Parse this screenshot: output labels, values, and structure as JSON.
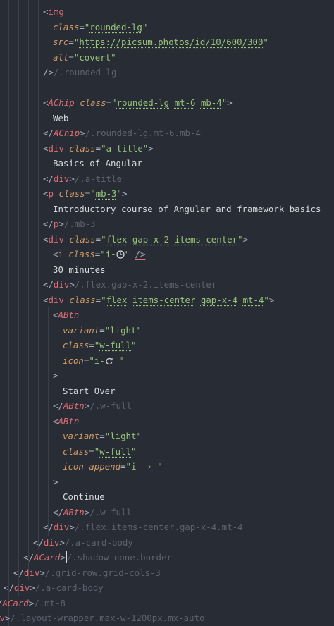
{
  "lines": [
    {
      "t": [
        [
          "p",
          "<"
        ],
        [
          "tag",
          "img"
        ]
      ]
    },
    {
      "t": [
        [
          "attr",
          "class"
        ],
        [
          "p",
          "="
        ],
        [
          "str",
          "\""
        ],
        [
          "str",
          "rounded-lg",
          "u"
        ],
        [
          "str",
          "\""
        ]
      ]
    },
    {
      "t": [
        [
          "attr",
          "src"
        ],
        [
          "p",
          "="
        ],
        [
          "str",
          "\""
        ],
        [
          "str",
          "https://picsum.photos/id/10/600/300",
          "u"
        ],
        [
          "str",
          "\""
        ]
      ]
    },
    {
      "t": [
        [
          "attr",
          "alt"
        ],
        [
          "p",
          "="
        ],
        [
          "str",
          "\"covert\""
        ]
      ]
    },
    {
      "t": [
        [
          "p",
          "/>"
        ],
        [
          "c",
          "/.rounded-lg"
        ]
      ]
    },
    {
      "t": []
    },
    {
      "t": [
        [
          "p",
          "<"
        ],
        [
          "comp",
          "AChip"
        ],
        [
          "p",
          " "
        ],
        [
          "attr",
          "class"
        ],
        [
          "p",
          "="
        ],
        [
          "str",
          "\""
        ],
        [
          "str",
          "rounded-lg",
          "u"
        ],
        [
          "str",
          " "
        ],
        [
          "str",
          "mt-6",
          "u"
        ],
        [
          "str",
          " "
        ],
        [
          "str",
          "mb-4",
          "u"
        ],
        [
          "str",
          "\""
        ],
        [
          "p",
          ">"
        ]
      ]
    },
    {
      "t": [
        [
          "txt",
          "Web"
        ]
      ]
    },
    {
      "t": [
        [
          "p",
          "</"
        ],
        [
          "comp",
          "AChip"
        ],
        [
          "p",
          ">"
        ],
        [
          "c",
          "/.rounded-lg.mt-6.mb-4"
        ]
      ]
    },
    {
      "t": [
        [
          "p",
          "<"
        ],
        [
          "tag",
          "div"
        ],
        [
          "p",
          " "
        ],
        [
          "attr",
          "class"
        ],
        [
          "p",
          "="
        ],
        [
          "str",
          "\"a-title\""
        ],
        [
          "p",
          ">"
        ]
      ]
    },
    {
      "t": [
        [
          "txt",
          "Basics of Angular"
        ]
      ]
    },
    {
      "t": [
        [
          "p",
          "</"
        ],
        [
          "tag",
          "div"
        ],
        [
          "p",
          ">"
        ],
        [
          "c",
          "/.a-title"
        ]
      ]
    },
    {
      "t": [
        [
          "p",
          "<"
        ],
        [
          "tag",
          "p"
        ],
        [
          "p",
          " "
        ],
        [
          "attr",
          "class"
        ],
        [
          "p",
          "="
        ],
        [
          "str",
          "\""
        ],
        [
          "str",
          "mb-3",
          "u"
        ],
        [
          "str",
          "\""
        ],
        [
          "p",
          ">"
        ]
      ]
    },
    {
      "t": [
        [
          "txt",
          "Introductory course of Angular and framework basics"
        ]
      ]
    },
    {
      "t": [
        [
          "p",
          "</"
        ],
        [
          "tag",
          "p"
        ],
        [
          "p",
          ">"
        ],
        [
          "c",
          "/.mb-3"
        ]
      ]
    },
    {
      "t": [
        [
          "p",
          "<"
        ],
        [
          "tag",
          "div"
        ],
        [
          "p",
          " "
        ],
        [
          "attr",
          "class"
        ],
        [
          "p",
          "="
        ],
        [
          "str",
          "\""
        ],
        [
          "str",
          "flex",
          "u"
        ],
        [
          "str",
          " "
        ],
        [
          "str",
          "gap-x-2",
          "u"
        ],
        [
          "str",
          " "
        ],
        [
          "str",
          "items-center",
          "u"
        ],
        [
          "str",
          "\""
        ],
        [
          "p",
          ">"
        ]
      ]
    },
    {
      "t": [
        [
          "p",
          "<"
        ],
        [
          "tag",
          "i"
        ],
        [
          "p",
          " "
        ],
        [
          "attr",
          "class"
        ],
        [
          "p",
          "="
        ],
        [
          "str",
          "\"i-"
        ],
        [
          "icon",
          "clock"
        ],
        [
          "str",
          "\""
        ],
        [
          "p",
          " "
        ],
        [
          "p",
          "/>",
          "ue"
        ]
      ]
    },
    {
      "t": [
        [
          "txt",
          "30 minutes"
        ]
      ]
    },
    {
      "t": [
        [
          "p",
          "</"
        ],
        [
          "tag",
          "div"
        ],
        [
          "p",
          ">"
        ],
        [
          "c",
          "/.flex.gap-x-2.items-center"
        ]
      ]
    },
    {
      "t": [
        [
          "p",
          "<"
        ],
        [
          "tag",
          "div"
        ],
        [
          "p",
          " "
        ],
        [
          "attr",
          "class"
        ],
        [
          "p",
          "="
        ],
        [
          "str",
          "\""
        ],
        [
          "str",
          "flex",
          "u"
        ],
        [
          "str",
          " "
        ],
        [
          "str",
          "items-center",
          "u"
        ],
        [
          "str",
          " "
        ],
        [
          "str",
          "gap-x-4",
          "u"
        ],
        [
          "str",
          " "
        ],
        [
          "str",
          "mt-4",
          "u"
        ],
        [
          "str",
          "\""
        ],
        [
          "p",
          ">"
        ]
      ]
    },
    {
      "t": [
        [
          "p",
          "<"
        ],
        [
          "comp",
          "ABtn"
        ]
      ]
    },
    {
      "t": [
        [
          "attr",
          "variant"
        ],
        [
          "p",
          "="
        ],
        [
          "str",
          "\"light\""
        ]
      ]
    },
    {
      "t": [
        [
          "attr",
          "class"
        ],
        [
          "p",
          "="
        ],
        [
          "str",
          "\""
        ],
        [
          "str",
          "w-full",
          "u"
        ],
        [
          "str",
          "\""
        ]
      ]
    },
    {
      "t": [
        [
          "attr",
          "icon"
        ],
        [
          "p",
          "="
        ],
        [
          "str",
          "\"i-"
        ],
        [
          "icon",
          "refresh"
        ],
        [
          "str",
          " \""
        ]
      ]
    },
    {
      "t": [
        [
          "p",
          ">"
        ]
      ]
    },
    {
      "t": [
        [
          "txt",
          "Start Over"
        ]
      ]
    },
    {
      "t": [
        [
          "p",
          "</"
        ],
        [
          "comp",
          "ABtn"
        ],
        [
          "p",
          ">"
        ],
        [
          "c",
          "/.w-full"
        ]
      ]
    },
    {
      "t": [
        [
          "p",
          "<"
        ],
        [
          "comp",
          "ABtn"
        ]
      ]
    },
    {
      "t": [
        [
          "attr",
          "variant"
        ],
        [
          "p",
          "="
        ],
        [
          "str",
          "\"light\""
        ]
      ]
    },
    {
      "t": [
        [
          "attr",
          "class"
        ],
        [
          "p",
          "="
        ],
        [
          "str",
          "\""
        ],
        [
          "str",
          "w-full",
          "u"
        ],
        [
          "str",
          "\""
        ]
      ]
    },
    {
      "t": [
        [
          "attr",
          "icon-append"
        ],
        [
          "p",
          "="
        ],
        [
          "str",
          "\"i- › \""
        ]
      ]
    },
    {
      "t": [
        [
          "p",
          ">"
        ]
      ]
    },
    {
      "t": [
        [
          "txt",
          "Continue"
        ]
      ]
    },
    {
      "t": [
        [
          "p",
          "</"
        ],
        [
          "comp",
          "ABtn"
        ],
        [
          "p",
          ">"
        ],
        [
          "c",
          "/.w-full"
        ]
      ]
    },
    {
      "t": [
        [
          "p",
          "</"
        ],
        [
          "tag",
          "div"
        ],
        [
          "p",
          ">"
        ],
        [
          "c",
          "/.flex.items-center.gap-x-4.mt-4"
        ]
      ]
    },
    {
      "t": [
        [
          "p",
          "</"
        ],
        [
          "tag",
          "div"
        ],
        [
          "p",
          ">"
        ],
        [
          "c",
          "/.a-card-body"
        ]
      ]
    },
    {
      "t": [
        [
          "p",
          "</"
        ],
        [
          "comp",
          "ACard"
        ],
        [
          "p",
          ">"
        ],
        [
          "cursor",
          ""
        ],
        [
          "c",
          "/.shadow-none.border"
        ]
      ]
    },
    {
      "t": [
        [
          "p",
          "</"
        ],
        [
          "tag",
          "div"
        ],
        [
          "p",
          ">"
        ],
        [
          "c",
          "/.grid-row.grid-cols-3"
        ]
      ]
    },
    {
      "t": [
        [
          "p",
          "</"
        ],
        [
          "tag",
          "div"
        ],
        [
          "p",
          ">"
        ],
        [
          "c",
          "/.a-card-body"
        ]
      ]
    },
    {
      "t": [
        [
          "p",
          "/"
        ],
        [
          "comp",
          "ACard"
        ],
        [
          "p",
          ">"
        ],
        [
          "c",
          "/.mt-8"
        ]
      ]
    },
    {
      "t": [
        [
          "tag",
          "iv"
        ],
        [
          "p",
          ">"
        ],
        [
          "c",
          "/.layout-wrapper.max-w-1200px.mx-auto"
        ]
      ]
    }
  ]
}
